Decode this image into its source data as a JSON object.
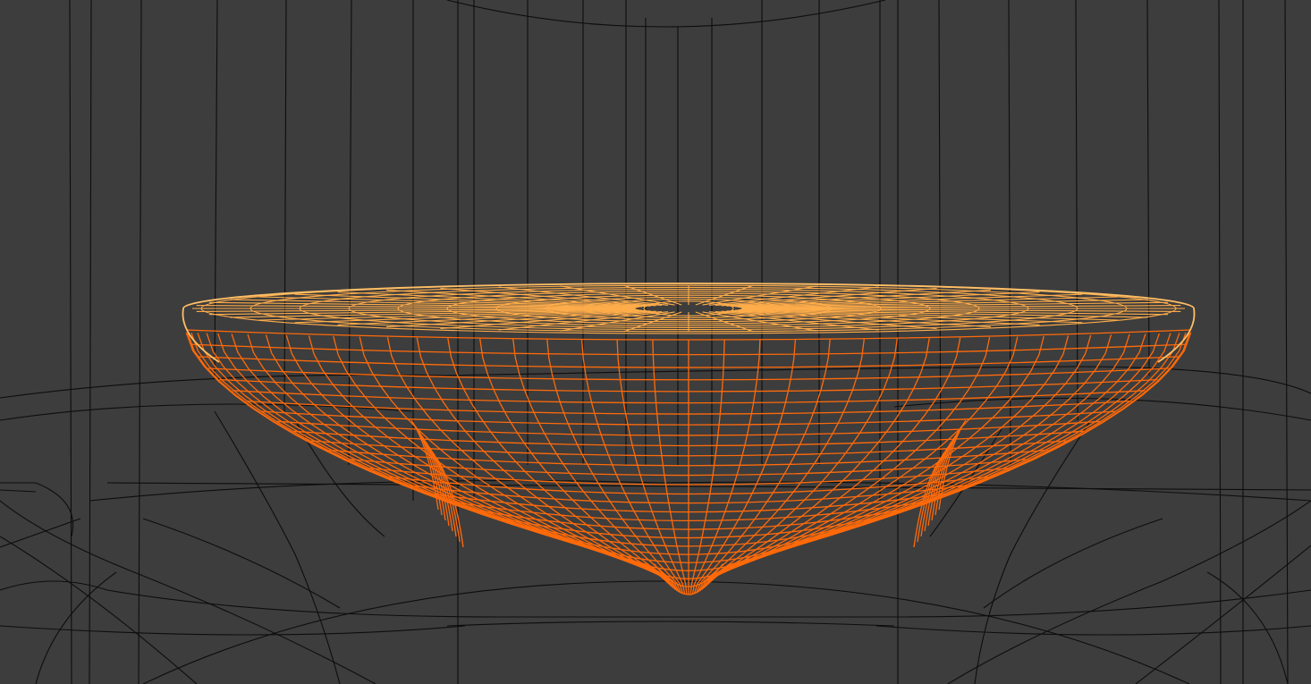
{
  "viewport": {
    "background_color": "#3d3d3d",
    "wire_color": "#0d0d0d",
    "selected_wire_color": "#ff6a0a",
    "selected_top_color": "#ffad4a",
    "selected_rim_color": "#ffbf66"
  }
}
